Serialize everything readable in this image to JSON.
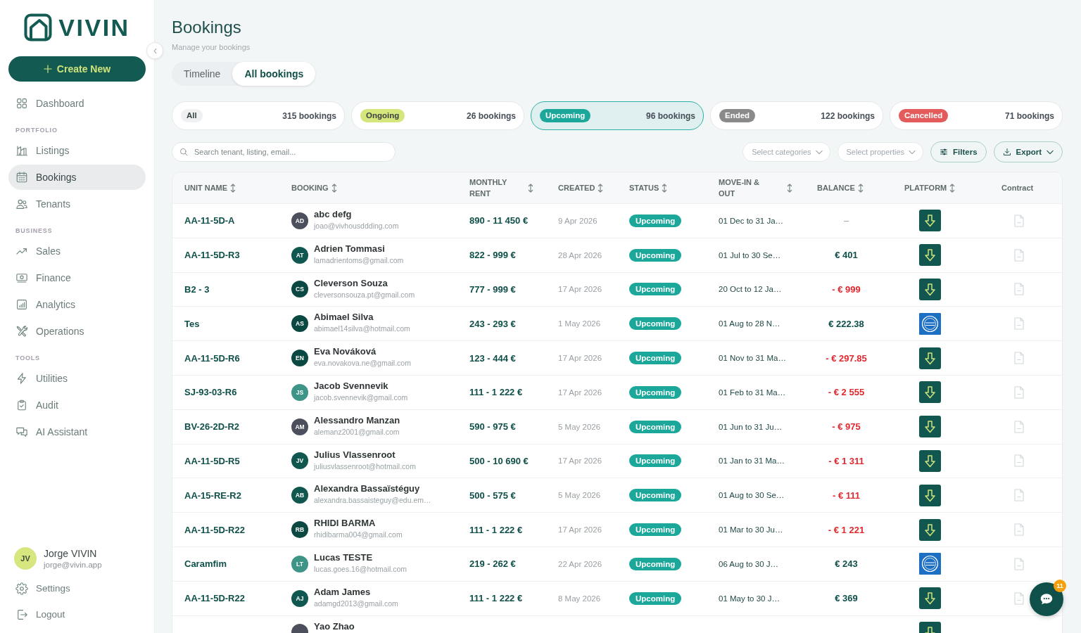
{
  "sidebar": {
    "logo": {
      "text": "VIVIN"
    },
    "create_button": {
      "label": "Create New"
    },
    "sections": [
      {
        "items": [
          {
            "label": "Dashboard",
            "selected": false
          }
        ]
      },
      {
        "title": "PORTFOLIO",
        "items": [
          {
            "label": "Listings",
            "selected": false
          },
          {
            "label": "Bookings",
            "selected": true
          },
          {
            "label": "Tenants",
            "selected": false
          }
        ]
      },
      {
        "title": "BUSINESS",
        "items": [
          {
            "label": "Sales",
            "selected": false
          },
          {
            "label": "Finance",
            "selected": false
          },
          {
            "label": "Analytics",
            "selected": false
          },
          {
            "label": "Operations",
            "selected": false
          }
        ]
      },
      {
        "title": "TOOLS",
        "items": [
          {
            "label": "Utilities",
            "selected": false
          },
          {
            "label": "Audit",
            "selected": false
          },
          {
            "label": "AI Assistant",
            "selected": false
          }
        ]
      }
    ],
    "user": {
      "initials": "JV",
      "name": "Jorge VIVIN",
      "email": "jorge@vivin.app"
    },
    "footer_items": [
      {
        "label": "Settings"
      },
      {
        "label": "Logout"
      }
    ]
  },
  "header": {
    "title": "Bookings",
    "subtitle": "Manage your bookings"
  },
  "tabs": [
    {
      "label": "Timeline",
      "selected": false
    },
    {
      "label": "All bookings",
      "selected": true
    }
  ],
  "status_cards": [
    {
      "label": "All",
      "count": "315 bookings",
      "color": "#eef0f2",
      "selected": false
    },
    {
      "label": "Ongoing",
      "count": "26 bookings",
      "color": "#d5e67c",
      "selected": false
    },
    {
      "label": "Upcoming",
      "count": "96 bookings",
      "color": "#1ba89b",
      "selected": true
    },
    {
      "label": "Ended",
      "count": "122 bookings",
      "color": "#8a8a8a",
      "selected": false
    },
    {
      "label": "Cancelled",
      "count": "71 bookings",
      "color": "#e35b5a",
      "selected": false
    }
  ],
  "filters": {
    "search": {
      "placeholder": "Search tenant, listing, email..."
    },
    "category_select": {
      "placeholder": "Select categories"
    },
    "property_select": {
      "placeholder": "Select properties"
    },
    "filters_button": {
      "label": "Filters"
    },
    "export_button": {
      "label": "Export"
    }
  },
  "table": {
    "columns": [
      {
        "label": "UNIT NAME",
        "sortable": true
      },
      {
        "label": "BOOKING",
        "sortable": true
      },
      {
        "label": "MONTHLY RENT",
        "sortable": true
      },
      {
        "label": "CREATED",
        "sortable": true
      },
      {
        "label": "STATUS",
        "sortable": true
      },
      {
        "label": "MOVE-IN & OUT",
        "sortable": true
      },
      {
        "label": "BALANCE",
        "sortable": true
      },
      {
        "label": "PLATFORM",
        "sortable": true
      },
      {
        "label": "Contract",
        "sortable": false
      }
    ],
    "rows": [
      {
        "unit": "AA-11-5D-A",
        "booking": {
          "initials": "AD",
          "name": "abc defg",
          "email": "joao@vivhousddding.com",
          "color": "#4b505c"
        },
        "rent": "890 - 11 450 €",
        "created": "9 Apr 2026",
        "status": "Upcoming",
        "move_dates": "01 Dec to 31 Ja…",
        "balance": {
          "text": "–",
          "kind": "none"
        },
        "platform": {
          "kind": "arrow"
        }
      },
      {
        "unit": "AA-11-5D-R3",
        "booking": {
          "initials": "AT",
          "name": "Adrien Tommasi",
          "email": "lamadrientoms@gmail.com",
          "color": "#10584f"
        },
        "rent": "822 - 999 €",
        "created": "28 Apr 2026",
        "status": "Upcoming",
        "move_dates": "01 Jul to 30 Se…",
        "balance": {
          "text": "€ 401",
          "kind": "credit"
        },
        "platform": {
          "kind": "arrow"
        }
      },
      {
        "unit": "B2 - 3",
        "booking": {
          "initials": "CS",
          "name": "Cleverson Souza",
          "email": "cleversonsouza.pt@gmail.com",
          "color": "#0c4842"
        },
        "rent": "777 - 999 €",
        "created": "17 Apr 2026",
        "status": "Upcoming",
        "move_dates": "20 Oct to 12 Ja…",
        "balance": {
          "text": "- € 999",
          "kind": "debit"
        },
        "platform": {
          "kind": "arrow"
        }
      },
      {
        "unit": "Tes",
        "booking": {
          "initials": "AS",
          "name": "Abimael Silva",
          "email": "abimael14silva@hotmail.com",
          "color": "#0c4842"
        },
        "rent": "243 - 293 €",
        "created": "1 May 2026",
        "status": "Upcoming",
        "move_dates": "01 Aug to 28 N…",
        "balance": {
          "text": "€ 222.38",
          "kind": "credit"
        },
        "platform": {
          "kind": "emblem"
        }
      },
      {
        "unit": "AA-11-5D-R6",
        "booking": {
          "initials": "EN",
          "name": "Eva Nováková",
          "email": "eva.novakova.ne@gmail.com",
          "color": "#0c4842"
        },
        "rent": "123 - 444 €",
        "created": "17 Apr 2026",
        "status": "Upcoming",
        "move_dates": "01 Nov to 31 Ma…",
        "balance": {
          "text": "- € 297.85",
          "kind": "debit"
        },
        "platform": {
          "kind": "arrow"
        }
      },
      {
        "unit": "SJ-93-03-R6",
        "booking": {
          "initials": "JS",
          "name": "Jacob Svennevik",
          "email": "jacob.svennevik@gmail.com",
          "color": "#3f9488"
        },
        "rent": "111 - 1 222 €",
        "created": "17 Apr 2026",
        "status": "Upcoming",
        "move_dates": "01 Feb to 31 Ma…",
        "balance": {
          "text": "- € 2 555",
          "kind": "debit"
        },
        "platform": {
          "kind": "arrow"
        }
      },
      {
        "unit": "BV-26-2D-R2",
        "booking": {
          "initials": "AM",
          "name": "Alessandro Manzan",
          "email": "alemanz2001@gmail.com",
          "color": "#4b505c"
        },
        "rent": "590 - 975 €",
        "created": "5 May 2026",
        "status": "Upcoming",
        "move_dates": "01 Jun to 31 Ju…",
        "balance": {
          "text": "- € 975",
          "kind": "debit"
        },
        "platform": {
          "kind": "arrow"
        }
      },
      {
        "unit": "AA-11-5D-R5",
        "booking": {
          "initials": "JV",
          "name": "Julius Vlassenroot",
          "email": "juliusvlassenroot@hotmail.com",
          "color": "#10584f"
        },
        "rent": "500 - 10 690 €",
        "created": "17 Apr 2026",
        "status": "Upcoming",
        "move_dates": "01 Jan to 31 Ma…",
        "balance": {
          "text": "- € 1 311",
          "kind": "debit"
        },
        "platform": {
          "kind": "arrow"
        }
      },
      {
        "unit": "AA-15-RE-R2",
        "booking": {
          "initials": "AB",
          "name": "Alexandra Bassaïstéguy",
          "email": "alexandra.bassaisteguy@edu.em…",
          "color": "#10584f"
        },
        "rent": "500 - 575 €",
        "created": "5 May 2026",
        "status": "Upcoming",
        "move_dates": "01 Aug to 30 Se…",
        "balance": {
          "text": "- € 111",
          "kind": "debit"
        },
        "platform": {
          "kind": "arrow"
        }
      },
      {
        "unit": "AA-11-5D-R22",
        "booking": {
          "initials": "RB",
          "name": "RHIDI BARMA",
          "email": "rhidibarma004@gmail.com",
          "color": "#0c4842"
        },
        "rent": "111 - 1 222 €",
        "created": "17 Apr 2026",
        "status": "Upcoming",
        "move_dates": "01 Mar to 30 Ju…",
        "balance": {
          "text": "- € 1 221",
          "kind": "debit"
        },
        "platform": {
          "kind": "arrow"
        }
      },
      {
        "unit": "Caramfim",
        "booking": {
          "initials": "LT",
          "name": "Lucas TESTE",
          "email": "lucas.goes.16@hotmail.com",
          "color": "#3f9488"
        },
        "rent": "219 - 262 €",
        "created": "22 Apr 2026",
        "status": "Upcoming",
        "move_dates": "06 Aug to 30 J…",
        "balance": {
          "text": "€ 243",
          "kind": "credit"
        },
        "platform": {
          "kind": "emblem"
        }
      },
      {
        "unit": "AA-11-5D-R22",
        "booking": {
          "initials": "AJ",
          "name": "Adam James",
          "email": "adamgd2013@gmail.com",
          "color": "#10584f"
        },
        "rent": "111 - 1 222 €",
        "created": "8 May 2026",
        "status": "Upcoming",
        "move_dates": "01 May to 30 J…",
        "balance": {
          "text": "€ 369",
          "kind": "credit"
        },
        "platform": {
          "kind": "arrow"
        }
      },
      {
        "booking": {
          "name": "Yao Zhao",
          "color": "#4b505c"
        },
        "platform": {
          "kind": "arrow"
        }
      }
    ]
  },
  "chat_button": {
    "badge": "11"
  }
}
